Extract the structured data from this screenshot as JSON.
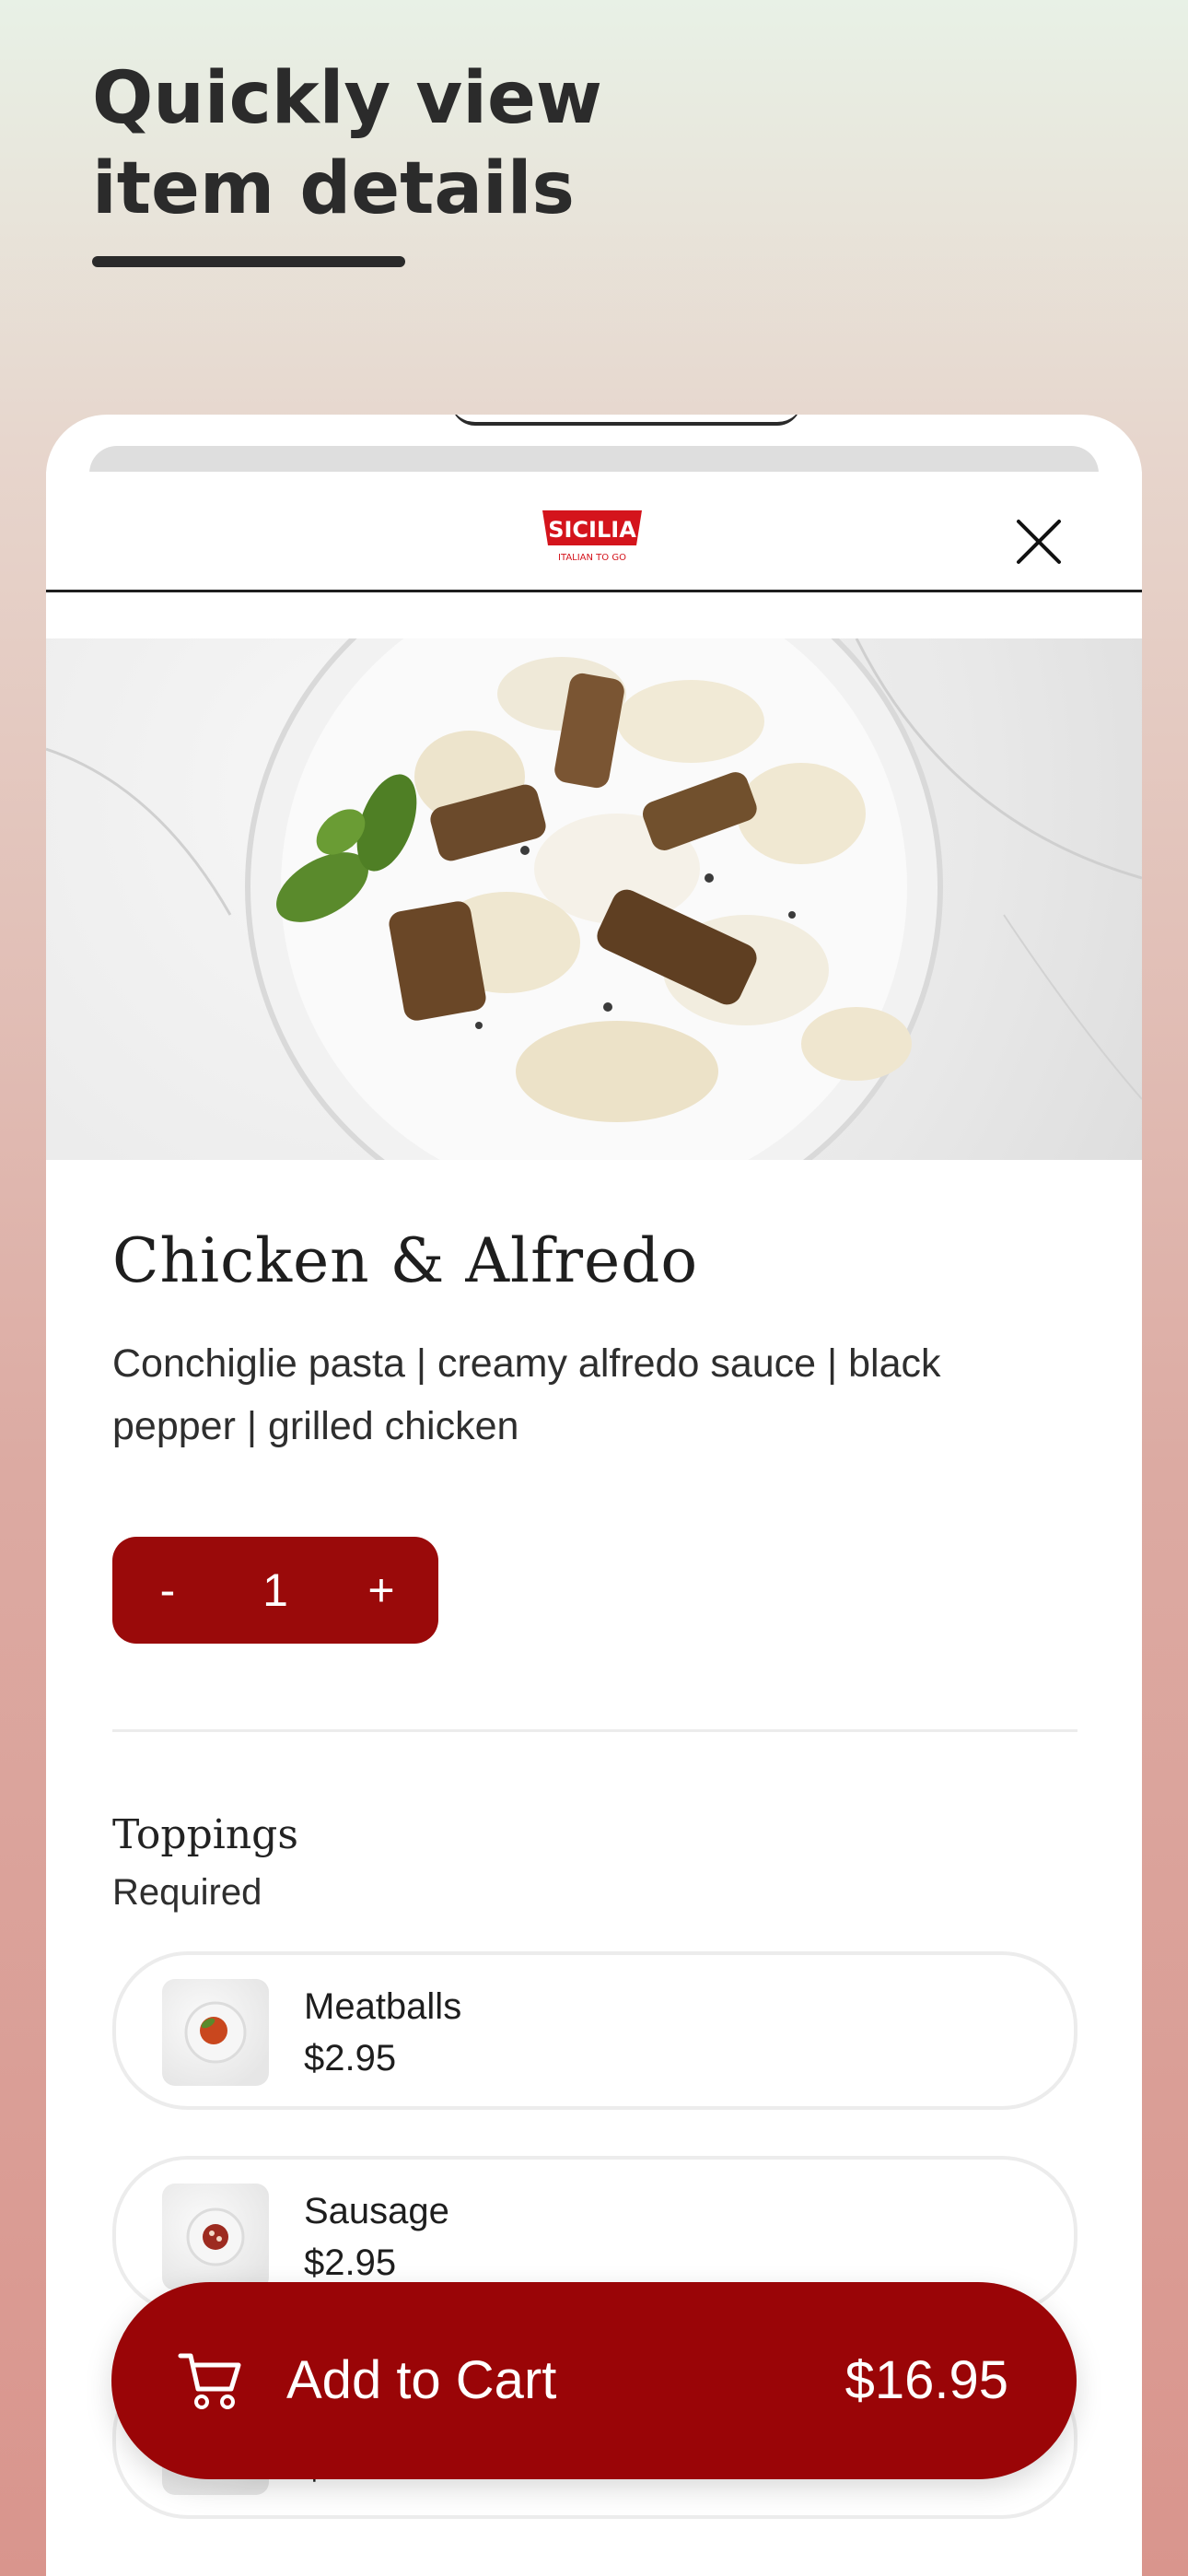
{
  "headline": "Quickly view item details",
  "brand": {
    "name": "SICILIA",
    "tagline": "ITALIAN TO GO"
  },
  "item": {
    "title": "Chicken & Alfredo",
    "description": "Conchiglie pasta | creamy alfredo sauce | black pepper | grilled chicken"
  },
  "stepper": {
    "minus": "-",
    "quantity": "1",
    "plus": "+"
  },
  "toppings": {
    "title": "Toppings",
    "subtitle": "Required",
    "options": [
      {
        "name": "Meatballs",
        "price": "$2.95"
      },
      {
        "name": "Sausage",
        "price": "$2.95"
      },
      {
        "name": "",
        "price": "$"
      }
    ]
  },
  "cart_button": {
    "label": "Add to Cart",
    "price": "$16.95"
  },
  "colors": {
    "brand_red": "#9a0507",
    "logo_red": "#d4141c",
    "text_dark": "#1e1e1e"
  },
  "icons": {
    "close": "close-icon",
    "cart": "cart-icon"
  }
}
